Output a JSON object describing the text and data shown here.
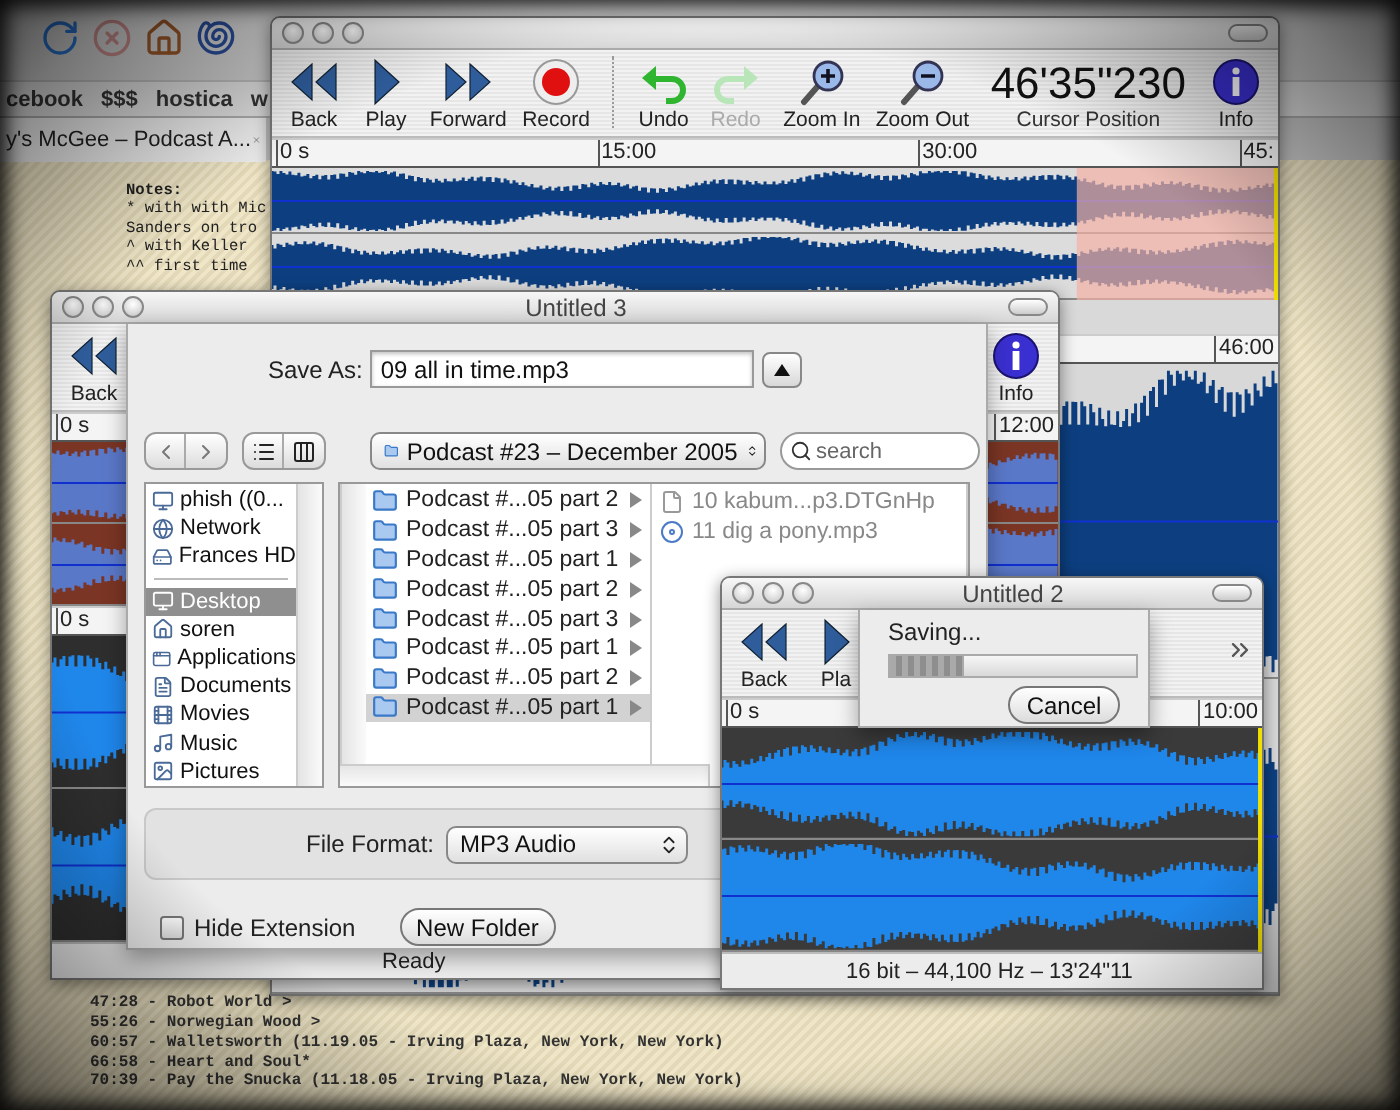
{
  "browser": {
    "bookmarks": [
      "cebook",
      "$$$",
      "hostica",
      "w"
    ],
    "tab": {
      "title": "y's McGee – Podcast A..."
    },
    "notes": {
      "heading": "Notes:",
      "lines": [
        "* with with Mic",
        "Sanders on tro",
        "^ with Keller",
        "^^ first time"
      ]
    },
    "tracklist": [
      "47:28 - Robot World >",
      "55:26 - Norwegian Wood >",
      "60:57 - Walletsworth (11.19.05 - Irving Plaza, New York, New York)",
      "66:58 - Heart and Soul*",
      "70:39 - Pay the Snucka (11.18.05 - Irving Plaza, New York, New York)"
    ]
  },
  "main_window": {
    "toolbar": [
      {
        "kind": "back",
        "label": "Back",
        "disabled": false
      },
      {
        "kind": "play",
        "label": "Play",
        "disabled": false
      },
      {
        "kind": "forward",
        "label": "Forward",
        "disabled": false
      },
      {
        "kind": "record",
        "label": "Record",
        "disabled": false
      },
      {
        "kind": "undo",
        "label": "Undo",
        "disabled": false
      },
      {
        "kind": "redo",
        "label": "Redo",
        "disabled": true
      },
      {
        "kind": "zoom_in",
        "label": "Zoom In",
        "disabled": false
      },
      {
        "kind": "zoom_out",
        "label": "Zoom Out",
        "disabled": false
      }
    ],
    "cursor_position": "46'35\"230",
    "cursor_label": "Cursor Position",
    "info": "Info",
    "ruler": [
      "0 s",
      "15:00",
      "30:00",
      "45:"
    ],
    "lower_ruler": [
      "46:00"
    ]
  },
  "save_window": {
    "title": "Untitled 3",
    "toolbar": [
      {
        "kind": "back",
        "label": "Back",
        "disabled": false
      }
    ],
    "info": "Info",
    "ruler": [
      "0 s",
      "12:00"
    ],
    "lower_ruler": [
      "0 s"
    ],
    "status": "Ready",
    "sheet": {
      "save_as_label": "Save As:",
      "file_name": "09 all in time.mp3",
      "location": "Podcast #23 – December 2005",
      "search": {
        "placeholder": "search"
      },
      "sidebar": {
        "devices": [
          {
            "kind": "computer",
            "label": "phish ((0...",
            "selected": false
          },
          {
            "kind": "network",
            "label": "Network",
            "selected": false
          },
          {
            "kind": "disk",
            "label": "Frances HD",
            "selected": false
          }
        ],
        "places": [
          {
            "kind": "desktop",
            "label": "Desktop",
            "selected": true
          },
          {
            "kind": "home",
            "label": "soren",
            "selected": false
          },
          {
            "kind": "apps",
            "label": "Applications",
            "selected": false
          },
          {
            "kind": "documents",
            "label": "Documents",
            "selected": false
          },
          {
            "kind": "movies",
            "label": "Movies",
            "selected": false
          },
          {
            "kind": "music",
            "label": "Music",
            "selected": false
          },
          {
            "kind": "pictures",
            "label": "Pictures",
            "selected": false
          }
        ]
      },
      "folders": [
        {
          "label": "Podcast #...05 part 2",
          "selected": false
        },
        {
          "label": "Podcast #...05 part 3",
          "selected": false
        },
        {
          "label": "Podcast #...05 part 1",
          "selected": false
        },
        {
          "label": "Podcast #...05 part 2",
          "selected": false
        },
        {
          "label": "Podcast #...05 part 3",
          "selected": false
        },
        {
          "label": "Podcast #...05 part 1",
          "selected": false
        },
        {
          "label": "Podcast #...05 part 2",
          "selected": false
        },
        {
          "label": "Podcast #...05 part 1",
          "selected": true
        }
      ],
      "files": [
        {
          "kind": "document",
          "label": "10 kabum...p3.DTGnHp"
        },
        {
          "kind": "audio",
          "label": "11 dig a pony.mp3"
        }
      ],
      "format_label": "File Format:",
      "format": "MP3 Audio",
      "hide_extension": {
        "label": "Hide Extension",
        "checked": false
      },
      "new_folder": "New Folder"
    }
  },
  "progress_window": {
    "title": "Untitled 2",
    "toolbar": [
      {
        "kind": "back",
        "label": "Back",
        "disabled": false
      },
      {
        "kind": "play",
        "label": "Pla",
        "disabled": false
      }
    ],
    "ruler": [
      "0 s",
      "10:00"
    ],
    "status": "16 bit – 44,100 Hz – 13'24\"11",
    "saving": {
      "message": "Saving...",
      "level": 0.3,
      "cancel": "Cancel"
    }
  }
}
